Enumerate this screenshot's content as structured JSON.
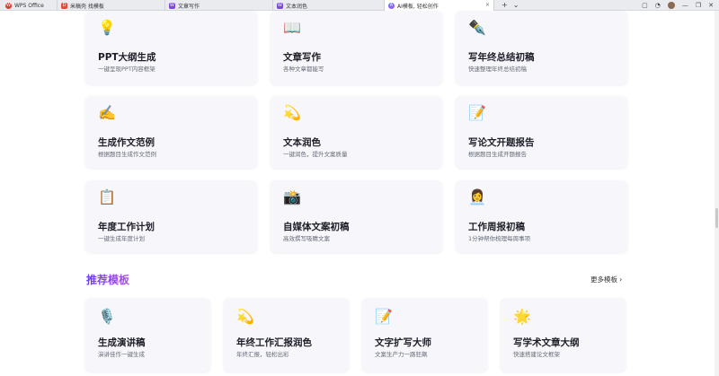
{
  "tabs": [
    {
      "label": "WPS Office",
      "icon": "wps-logo-icon"
    },
    {
      "label": "米稿壳 找模板",
      "icon": "doc-red-icon"
    },
    {
      "label": "文章写作",
      "icon": "doc-purple-icon"
    },
    {
      "label": "文本润色",
      "icon": "doc-purple-icon"
    },
    {
      "label": "AI模板, 轻松创作",
      "icon": "ai-logo-icon",
      "active": true
    }
  ],
  "tab_close": "×",
  "tabbar_tools": {
    "add": "+",
    "dropdown": "⌄"
  },
  "window_controls": {
    "restore": "▢",
    "help": "◔",
    "minimize": "—",
    "maximize": "❐",
    "close": "✕"
  },
  "cards": [
    {
      "emoji": "💡",
      "icon": "lightbulb-icon",
      "title": "PPT大纲生成",
      "desc": "一键呈现PPT内容框架"
    },
    {
      "emoji": "📖",
      "icon": "book-icon",
      "title": "文章写作",
      "desc": "各种文章都能写"
    },
    {
      "emoji": "✒️",
      "icon": "pen-icon",
      "title": "写年终总结初稿",
      "desc": "快速整理年终总结初稿"
    },
    {
      "emoji": "✍️",
      "icon": "writing-hand-icon",
      "title": "生成作文范例",
      "desc": "根据题目生成作文范例"
    },
    {
      "emoji": "💫",
      "icon": "sparkle-icon",
      "title": "文本润色",
      "desc": "一键润色，提升文案质量"
    },
    {
      "emoji": "📝",
      "icon": "memo-icon",
      "title": "写论文开题报告",
      "desc": "根据题目生成开题报告"
    },
    {
      "emoji": "📋",
      "icon": "clipboard-icon",
      "title": "年度工作计划",
      "desc": "一键生成年度计划"
    },
    {
      "emoji": "📸",
      "icon": "camera-icon",
      "title": "自媒体文案初稿",
      "desc": "高效撰写吸睛文案"
    },
    {
      "emoji": "👩‍💼",
      "icon": "office-worker-icon",
      "title": "工作周报初稿",
      "desc": "1分钟帮你梳理每周事项"
    }
  ],
  "recommended": {
    "title": "推荐模板",
    "more": "更多模板",
    "items": [
      {
        "emoji": "🎙️",
        "icon": "microphone-icon",
        "title": "生成演讲稿",
        "desc": "演讲佳作一键生成"
      },
      {
        "emoji": "💫",
        "icon": "sparkle-icon",
        "title": "年终工作汇报润色",
        "desc": "年终汇报，轻松出彩"
      },
      {
        "emoji": "📝",
        "icon": "memo-icon",
        "title": "文字扩写大师",
        "desc": "文案生产力一路狂飙"
      },
      {
        "emoji": "🌟",
        "icon": "glowing-star-icon",
        "title": "写学术文章大纲",
        "desc": "快速搭建论文框架"
      }
    ]
  }
}
